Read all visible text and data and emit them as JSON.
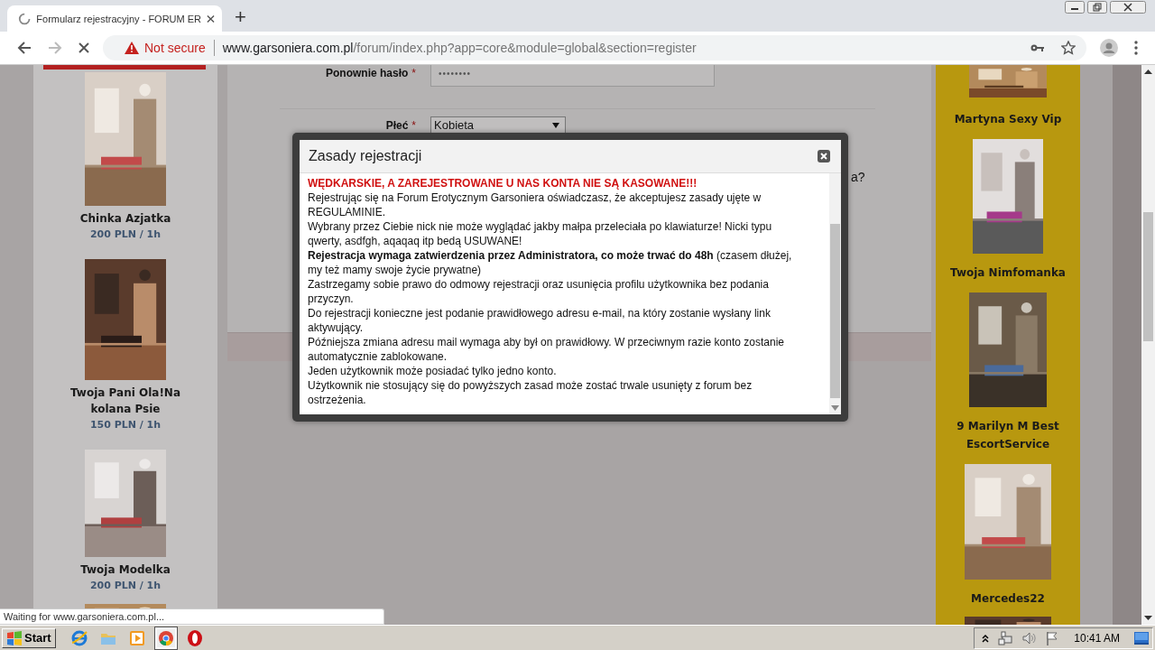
{
  "browser": {
    "tab": {
      "title": "Formularz rejestracyjny - FORUM ER",
      "loading": true
    },
    "new_tab": "+",
    "address": {
      "security": "Not secure",
      "host": "www.garsoniera.com.pl",
      "path": "/forum/index.php?app=core&module=global&section=register"
    },
    "status": "Waiting for www.garsoniera.com.pl..."
  },
  "left_ads": [
    {
      "name": "Chinka Azjatka",
      "price": "200 PLN / 1h"
    },
    {
      "name": "Twoja Pani Ola!Na kolana Psie",
      "price": "150 PLN / 1h"
    },
    {
      "name": "Twoja Modelka",
      "price": "200 PLN / 1h"
    }
  ],
  "form": {
    "fields": [
      {
        "kind": "password",
        "label": "Ponownie hasło",
        "mark": "*",
        "value": "••••••••"
      },
      {
        "kind": "select",
        "label": "Płeć",
        "mark": "*",
        "value": "Kobieta"
      }
    ],
    "hidden_row_end": "a?"
  },
  "right_ads": [
    {
      "name": "Martyna Sexy Vip"
    },
    {
      "name": "Twoja Nimfomanka"
    },
    {
      "name": "9 Marilyn M Best EscortService"
    },
    {
      "name": "Mercedes22"
    }
  ],
  "modal": {
    "title": "Zasady rejestracji",
    "warning": "WĘDKARSKIE, A ZAREJESTROWANE U NAS KONTA NIE SĄ KASOWANE!!!",
    "rules": [
      "Rejestrując się na Forum Erotycznym Garsoniera oświadczasz, że akceptujesz zasady ujęte w REGULAMINIE.",
      "Wybrany przez Ciebie nick nie może wyglądać jakby małpa przeleciała po klawiaturze! Nicki typu qwerty, asdfgh, aqaqaq itp bedą USUWANE!",
      "**Rejestracja wymaga zatwierdzenia przez Administratora, co może trwać do 48h** (czasem dłużej, my też mamy swoje życie prywatne)",
      "Zastrzegamy sobie prawo do odmowy rejestracji oraz usunięcia profilu użytkownika bez podania przyczyn.",
      "Do rejestracji konieczne jest podanie prawidłowego adresu e-mail, na który zostanie wysłany link aktywujący.",
      "Późniejsza zmiana adresu mail wymaga aby był on prawidłowy. W przeciwnym razie konto zostanie automatycznie zablokowane.",
      "Jeden użytkownik może posiadać tylko jedno konto.",
      "Użytkownik nie stosujący się do powyższych zasad może zostać trwale usunięty z forum bez ostrzeżenia."
    ]
  },
  "taskbar": {
    "start": "Start",
    "apps": [
      {
        "kind": "ie",
        "selected": false
      },
      {
        "kind": "folder",
        "selected": false
      },
      {
        "kind": "media",
        "selected": false
      },
      {
        "kind": "chrome",
        "selected": true
      },
      {
        "kind": "opera",
        "selected": false
      }
    ],
    "clock": "10:41 AM"
  }
}
